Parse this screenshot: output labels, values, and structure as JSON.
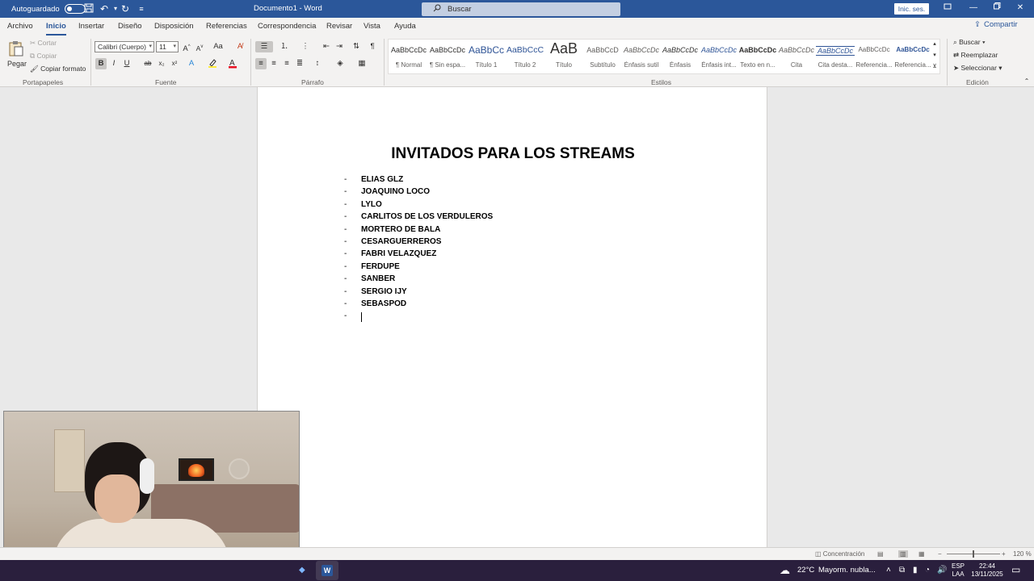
{
  "titlebar": {
    "autosave_label": "Autoguardado",
    "doc_title": "Documento1 - Word",
    "search_placeholder": "Buscar",
    "signin_label": "Inic. ses."
  },
  "tabs": [
    "Archivo",
    "Inicio",
    "Insertar",
    "Diseño",
    "Disposición",
    "Referencias",
    "Correspondencia",
    "Revisar",
    "Vista",
    "Ayuda"
  ],
  "active_tab": "Inicio",
  "share_label": "Compartir",
  "ribbon": {
    "clipboard": {
      "paste": "Pegar",
      "cut": "Cortar",
      "copy": "Copiar",
      "format_painter": "Copiar formato",
      "group": "Portapapeles"
    },
    "font": {
      "font_name": "Calibri (Cuerpo)",
      "font_size": "11",
      "change_case": "Aa",
      "group": "Fuente"
    },
    "paragraph": {
      "group": "Párrafo"
    },
    "styles": {
      "group": "Estilos",
      "items": [
        {
          "preview": "AaBbCcDc",
          "name": "¶ Normal"
        },
        {
          "preview": "AaBbCcDc",
          "name": "¶ Sin espa..."
        },
        {
          "preview": "AaBbCc",
          "name": "Título 1"
        },
        {
          "preview": "AaBbCcC",
          "name": "Título 2"
        },
        {
          "preview": "AaB",
          "name": "Título"
        },
        {
          "preview": "AaBbCcD",
          "name": "Subtítulo"
        },
        {
          "preview": "AaBbCcDc",
          "name": "Énfasis sutil"
        },
        {
          "preview": "AaBbCcDc",
          "name": "Énfasis"
        },
        {
          "preview": "AaBbCcDc",
          "name": "Énfasis int..."
        },
        {
          "preview": "AaBbCcDc",
          "name": "Texto en n..."
        },
        {
          "preview": "AaBbCcDc",
          "name": "Cita"
        },
        {
          "preview": "AaBbCcDc",
          "name": "Cita desta..."
        },
        {
          "preview": "AaBbCcDc",
          "name": "Referencia..."
        },
        {
          "preview": "AaBbCcDc",
          "name": "Referencia..."
        }
      ]
    },
    "editing": {
      "find": "Buscar",
      "replace": "Reemplazar",
      "select": "Seleccionar",
      "group": "Edición"
    }
  },
  "document": {
    "title": "INVITADOS PARA LOS STREAMS",
    "bullet": "-",
    "items": [
      "ELIAS GLZ",
      "JOAQUINO LOCO",
      "LYLO",
      "CARLITOS DE LOS VERDULEROS",
      "MORTERO DE BALA",
      "CESARGUERREROS",
      "FABRI VELAZQUEZ",
      "FERDUPE",
      "SANBER",
      "SERGIO IJY",
      "SEBASPOD"
    ]
  },
  "statusbar": {
    "focus": "Concentración",
    "zoom": "120 %"
  },
  "taskbar": {
    "weather_temp": "22°C",
    "weather_desc": "Mayorm. nubla...",
    "lang": "ESP",
    "layout": "LAA",
    "time": "22:44",
    "date": "13/11/2025"
  },
  "colors": {
    "word_blue": "#2b579a",
    "ribbon_bg": "#f3f2f1",
    "canvas_bg": "#e9e9e9"
  },
  "icons": [
    "save-icon",
    "undo-icon",
    "redo-icon",
    "search-icon",
    "minimize-icon",
    "maximize-icon",
    "close-icon",
    "share-icon",
    "word-app-icon",
    "notification-icon"
  ]
}
